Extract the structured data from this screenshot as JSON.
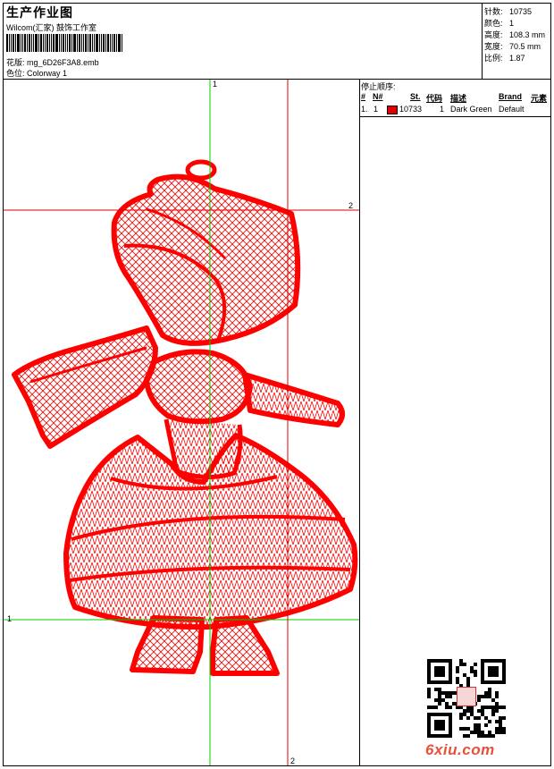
{
  "header": {
    "title": "生产作业图",
    "company": "Wilcom(汇家) 鼓饰工作室",
    "design_label": "花版:",
    "design_value": "mg_6D26F3A8.emb",
    "colorway_label": "色位:",
    "colorway_value": "Colorway 1"
  },
  "stats": [
    {
      "label": "针数:",
      "value": "10735"
    },
    {
      "label": "颜色:",
      "value": "1"
    },
    {
      "label": "高度:",
      "value": "108.3 mm"
    },
    {
      "label": "宽度:",
      "value": "70.5 mm"
    },
    {
      "label": "比例:",
      "value": "1.87"
    }
  ],
  "stop_sequence": {
    "title": "停止顺序:",
    "headers": {
      "num": "#",
      "needle": "N#",
      "stitches": "St.",
      "code": "代码",
      "description": "描述",
      "brand": "Brand",
      "element": "元素"
    },
    "rows": [
      {
        "num": "1.",
        "needle": "1",
        "stitches": "10733",
        "code": "1",
        "description": "Dark Green",
        "brand": "Default",
        "swatch_color": "#e00000"
      }
    ]
  },
  "guides": {
    "green_top": "1",
    "green_left": "1",
    "red_right": "2",
    "red_bottom": "2"
  },
  "colors": {
    "stitch": "#ff0000",
    "guide_green": "#00cc00",
    "guide_red": "#dd0000"
  },
  "watermark": "6xiu.com"
}
